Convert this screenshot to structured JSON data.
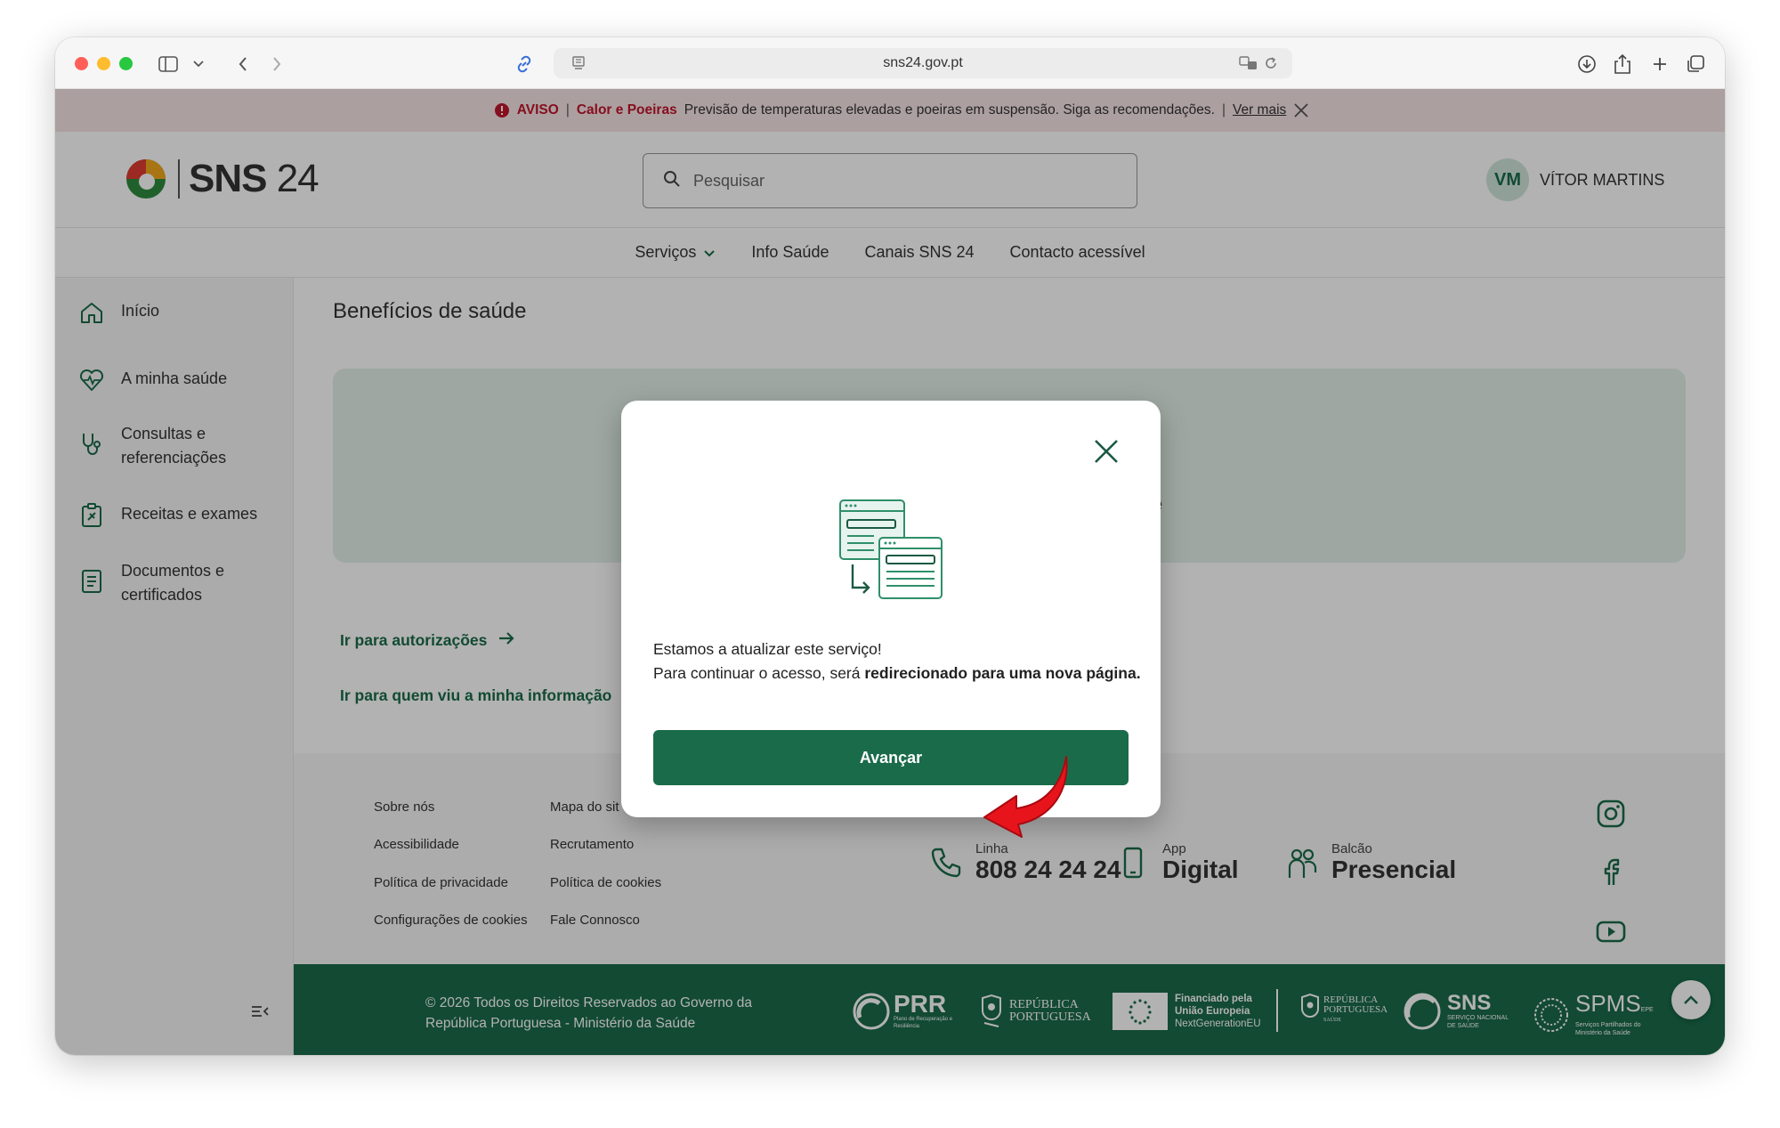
{
  "browser": {
    "url": "sns24.gov.pt"
  },
  "banner": {
    "level": "AVISO",
    "topic": "Calor e Poeiras",
    "message": "Previsão de temperaturas elevadas e poeiras em suspensão. Siga as recomendações.",
    "link_label": "Ver mais"
  },
  "header": {
    "brand_bold": "SNS",
    "brand_number": " 24",
    "search_placeholder": "Pesquisar",
    "user_initials": "VM",
    "user_name": "VÍTOR MARTINS"
  },
  "nav": {
    "items": [
      "Serviços",
      "Info Saúde",
      "Canais SNS 24",
      "Contacto acessível"
    ]
  },
  "sidebar": {
    "items": [
      {
        "label": "Início",
        "icon": "home-icon"
      },
      {
        "label": "A minha saúde",
        "icon": "heart-pulse-icon"
      },
      {
        "label_1": "Consultas e",
        "label_2": "referenciações",
        "icon": "stethoscope-icon"
      },
      {
        "label": "Receitas e exames",
        "icon": "clipboard-icon"
      },
      {
        "label_1": "Documentos e",
        "label_2": "certificados",
        "icon": "document-icon"
      }
    ]
  },
  "main": {
    "title": "Benefícios de saúde",
    "card_fragment": "e",
    "actions": [
      "Ir para autorizações",
      "Ir para quem viu a minha informação"
    ]
  },
  "footer": {
    "links_col1": [
      "Sobre nós",
      "Acessibilidade",
      "Política de privacidade",
      "Configurações de cookies"
    ],
    "links_col2": [
      "Mapa do sit",
      "Recrutamento",
      "Política de cookies",
      "Fale Connosco"
    ],
    "contacts": [
      {
        "small": "Linha",
        "big": "808 24 24 24",
        "icon": "phone-icon"
      },
      {
        "small": "App",
        "big": "Digital",
        "icon": "smartphone-icon"
      },
      {
        "small": "Balcão",
        "big": "Presencial",
        "icon": "people-icon"
      }
    ],
    "copyright_1": "© 2026 Todos os Direitos Reservados ao Governo da",
    "copyright_2": "República Portuguesa - Ministério da Saúde",
    "partners": {
      "prr": "PRR",
      "prr_sub": "Plano de Recuperação e Resiliência",
      "rp_1": "REPÚBLICA",
      "rp_2": "PORTUGUESA",
      "eu_1": "Financiado pela",
      "eu_2": "União Europeia",
      "eu_3": "NextGenerationEU",
      "rp2_1": "REPÚBLICA",
      "rp2_2": "PORTUGUESA",
      "rp2_3": "SAÚDE",
      "sns": "SNS",
      "sns_sub_1": "SERVIÇO NACIONAL",
      "sns_sub_2": "DE SAÚDE",
      "spms": "SPMS",
      "spms_suffix": "EPE",
      "spms_sub_1": "Serviços Partilhados do",
      "spms_sub_2": "Ministério da Saúde"
    }
  },
  "modal": {
    "line1": "Estamos a atualizar este serviço!",
    "line2_prefix": "Para continuar o acesso, será ",
    "line2_bold": "redirecionado para uma nova página.",
    "button_label": "Avançar"
  },
  "colors": {
    "brand_green": "#1a6b4a",
    "alert_red": "#c0162a",
    "banner_bg": "#f6e4e6",
    "annotation_arrow": "#e8141c"
  }
}
